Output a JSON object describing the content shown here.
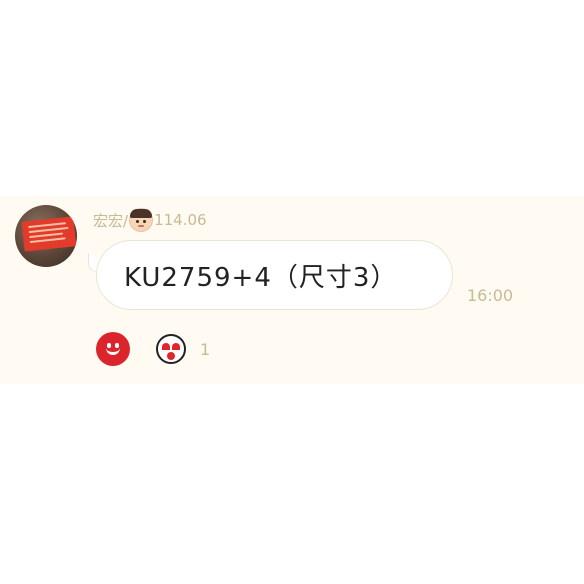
{
  "message": {
    "sender_name": "宏宏/",
    "sender_suffix": "114.06",
    "text": "KU2759+4（尺寸3）",
    "time": "16:00"
  },
  "reactions": {
    "items": [
      {
        "icon": "heart-eyes-face-icon",
        "count": "1"
      }
    ]
  },
  "colors": {
    "band": "#fffbf2",
    "meta_text": "#c9b994",
    "add_reaction": "#d9252b"
  }
}
